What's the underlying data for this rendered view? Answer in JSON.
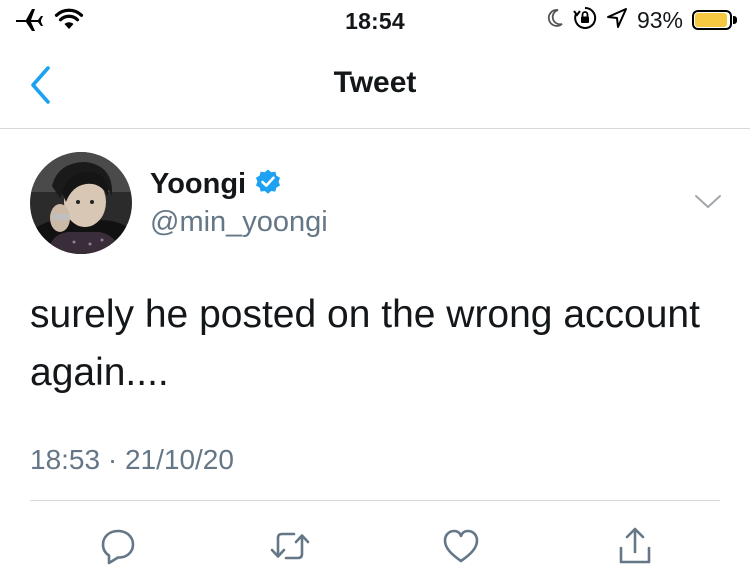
{
  "status_bar": {
    "time": "18:54",
    "battery_percent_text": "93%",
    "battery_level": 0.93,
    "battery_color": "#f7c940",
    "icons": [
      "airplane-icon",
      "wifi-icon",
      "moon-icon",
      "orientation-lock-icon",
      "location-arrow-icon",
      "battery-icon"
    ]
  },
  "nav": {
    "title": "Tweet",
    "back_icon": "chevron-left-icon",
    "accent_color": "#1da1f2"
  },
  "tweet": {
    "author": {
      "name": "Yoongi",
      "handle": "@min_yoongi",
      "verified": true
    },
    "text": "surely he posted on the wrong account again....",
    "timestamp": "18:53 · 21/10/20"
  },
  "actions": [
    {
      "name": "reply",
      "icon": "reply-icon"
    },
    {
      "name": "retweet",
      "icon": "retweet-icon"
    },
    {
      "name": "like",
      "icon": "heart-icon"
    },
    {
      "name": "share",
      "icon": "share-icon"
    }
  ]
}
